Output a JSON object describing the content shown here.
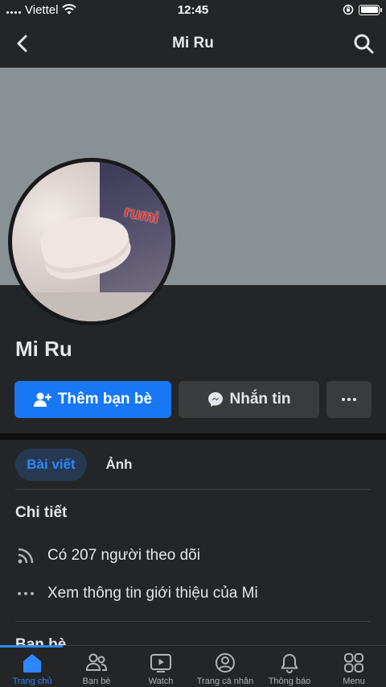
{
  "status_bar": {
    "carrier": "Viettel",
    "time": "12:45"
  },
  "nav": {
    "title": "Mi Ru"
  },
  "profile": {
    "name": "Mi Ru",
    "avatar_sticker": "rumi"
  },
  "actions": {
    "add_friend_label": "Thêm bạn bè",
    "message_label": "Nhắn tin"
  },
  "tabs": [
    {
      "label": "Bài viết",
      "active": true
    },
    {
      "label": "Ảnh",
      "active": false
    }
  ],
  "details": {
    "title": "Chi tiết",
    "followers": "Có 207 người theo dõi",
    "about": "Xem thông tin giới thiệu của Mi"
  },
  "friends": {
    "title": "Bạn bè"
  },
  "tabbar": [
    {
      "label": "Trang chủ",
      "icon": "home-icon",
      "active": true
    },
    {
      "label": "Bạn bè",
      "icon": "friends-icon",
      "active": false
    },
    {
      "label": "Watch",
      "icon": "watch-icon",
      "active": false
    },
    {
      "label": "Trang cá nhân",
      "icon": "profile-icon",
      "active": false
    },
    {
      "label": "Thông báo",
      "icon": "bell-icon",
      "active": false
    },
    {
      "label": "Menu",
      "icon": "menu-icon",
      "active": false
    }
  ],
  "colors": {
    "accent": "#1877f2",
    "active_tab": "#2d88ff",
    "background": "#18191a",
    "surface": "#242526"
  }
}
